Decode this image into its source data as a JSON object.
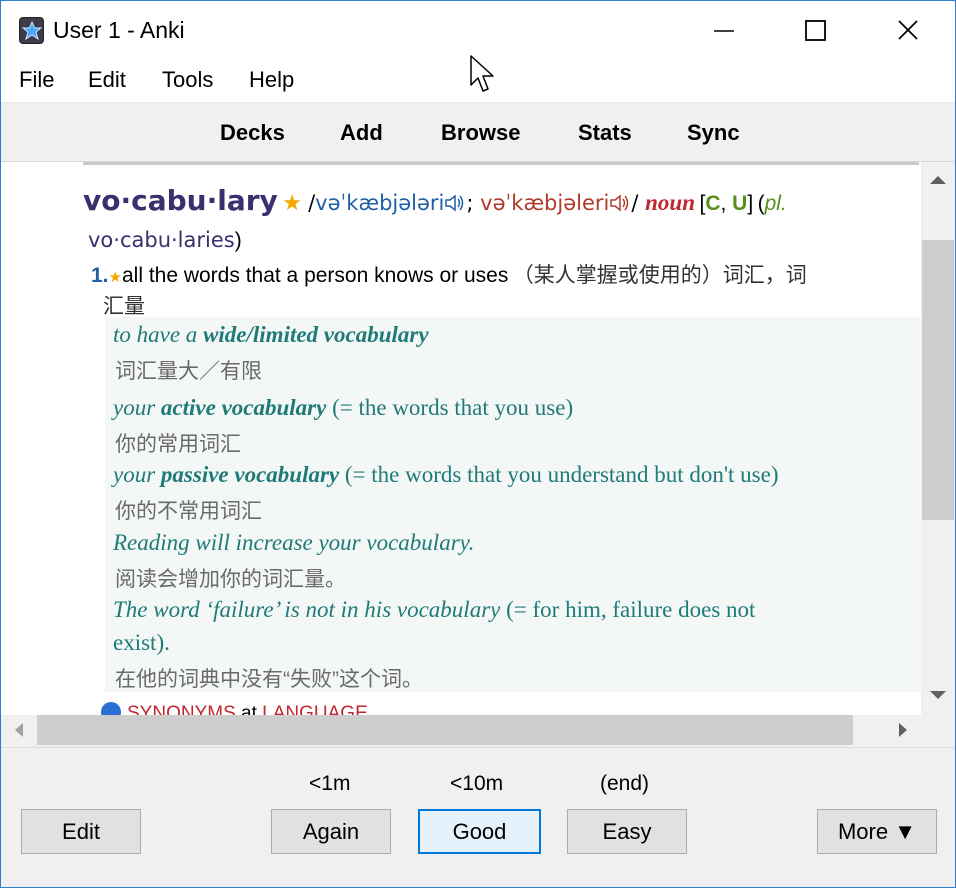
{
  "window": {
    "title": "User 1 - Anki"
  },
  "menu": [
    "File",
    "Edit",
    "Tools",
    "Help"
  ],
  "toolbar": [
    "Decks",
    "Add",
    "Browse",
    "Stats",
    "Sync"
  ],
  "entry": {
    "headword": "vo·cabu·lary",
    "pron_br": "vəˈkæbjələri",
    "pron_us": "vəˈkæbjəleri",
    "pos": "noun",
    "grammar_open": "[",
    "grammar_c": "C",
    "grammar_sep": ", ",
    "grammar_u": "U",
    "grammar_close": "]",
    "plural_label": "pl.",
    "plural_form": "vo·cabu·laries",
    "sense_number": "1.",
    "definition": "all the words that a person knows or uses",
    "definition_zh_1": "（某人掌握或使用的）词汇，词",
    "definition_zh_2": "汇量",
    "examples": [
      {
        "pre": "to have a ",
        "bold": "wide/limited vocabulary",
        "post": "",
        "post_roman": "",
        "zh": "词汇量大／有限"
      },
      {
        "pre": "your ",
        "bold": "active vocabulary",
        "post": "",
        "post_roman": " (= the words that you use)",
        "zh": "你的常用词汇"
      },
      {
        "pre": "your ",
        "bold": "passive vocabulary",
        "post": "",
        "post_roman": " (= the words that you understand but don't use)",
        "zh": "你的不常用词汇"
      },
      {
        "pre": "Reading will increase your vocabulary.",
        "bold": "",
        "post": "",
        "post_roman": "",
        "zh": "阅读会增加你的词汇量。"
      },
      {
        "pre": "The word ‘failure’ is not in his vocabulary",
        "bold": "",
        "post": "",
        "post_roman": " (= for him, failure does not",
        "post_roman_2": "exist).",
        "zh": "在他的词典中没有“失败”这个词。"
      }
    ],
    "synonyms_label": "SYNONYMS",
    "synonyms_at": " at ",
    "synonyms_target": "LANGUAGE"
  },
  "review": {
    "interval_again": "<1m",
    "interval_good": "<10m",
    "interval_easy": "(end)",
    "edit": "Edit",
    "again": "Again",
    "good": "Good",
    "easy": "Easy",
    "more": "More ▼"
  }
}
